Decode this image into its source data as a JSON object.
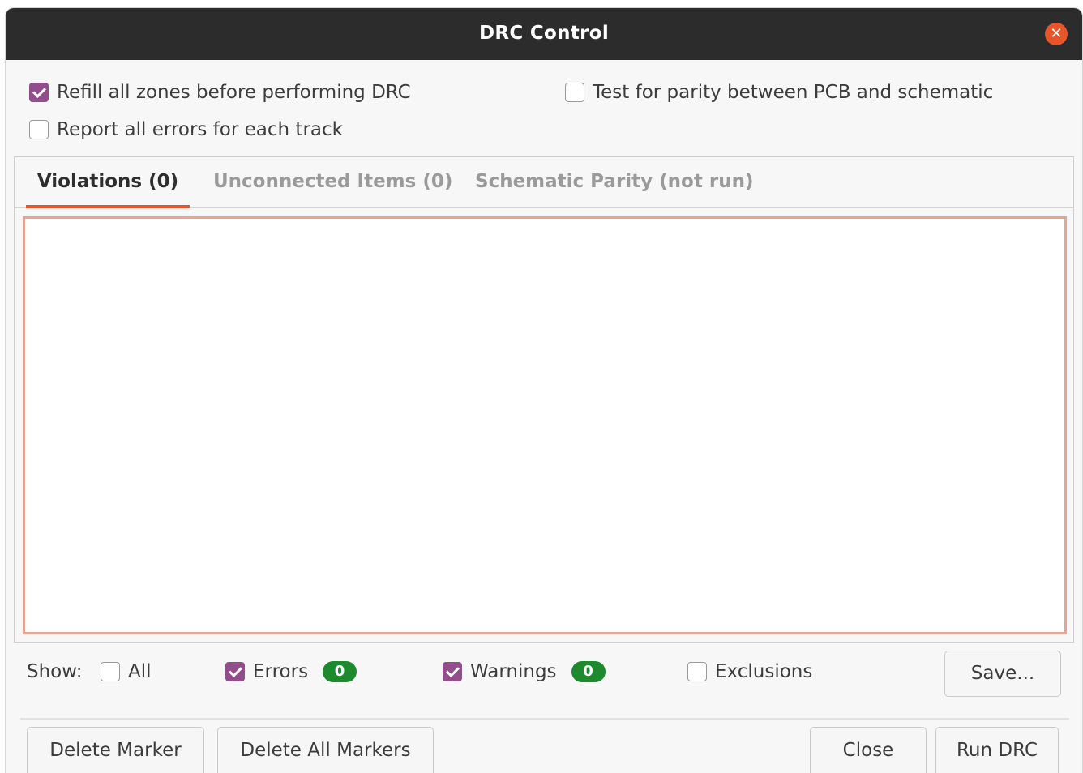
{
  "window": {
    "title": "DRC Control",
    "close_icon": "close-icon"
  },
  "options": {
    "refill_zones": {
      "label": "Refill all zones before performing DRC",
      "checked": true
    },
    "report_all_errors": {
      "label": "Report all errors for each track",
      "checked": false
    },
    "test_parity": {
      "label": "Test for parity between PCB and schematic",
      "checked": false
    }
  },
  "tabs": [
    {
      "label": "Violations (0)",
      "active": true
    },
    {
      "label": "Unconnected Items (0)",
      "active": false
    },
    {
      "label": "Schematic Parity (not run)",
      "active": false
    }
  ],
  "filters": {
    "show_label": "Show:",
    "all": {
      "label": "All",
      "checked": false
    },
    "errors": {
      "label": "Errors",
      "checked": true,
      "count": "0"
    },
    "warnings": {
      "label": "Warnings",
      "checked": true,
      "count": "0"
    },
    "exclusions": {
      "label": "Exclusions",
      "checked": false
    },
    "save_label": "Save..."
  },
  "buttons": {
    "delete_marker": "Delete Marker",
    "delete_all_markers": "Delete All Markers",
    "close": "Close",
    "run_drc": "Run DRC"
  },
  "colors": {
    "accent": "#e9552b",
    "checkbox": "#924d8b",
    "badge": "#1e8a2e",
    "titlebar": "#2c2c2c"
  }
}
